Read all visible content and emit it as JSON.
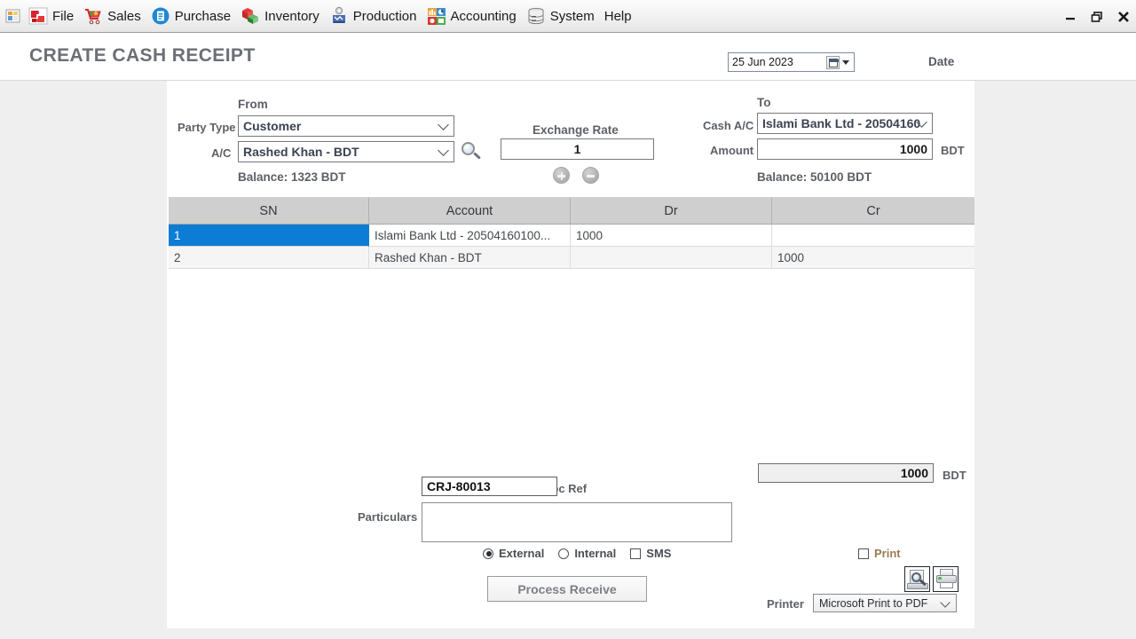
{
  "window": {
    "controls": [
      {
        "name": "minimize",
        "glyph": "–"
      },
      {
        "name": "restore",
        "glyph": "❐"
      },
      {
        "name": "close",
        "glyph": "✕"
      }
    ]
  },
  "menubar": {
    "app_icon": "app-squares-icon",
    "items": [
      {
        "label": "File",
        "icon": "puzzle-icon"
      },
      {
        "label": "Sales",
        "icon": "shopping-cart-icon"
      },
      {
        "label": "Purchase",
        "icon": "document-blue-icon"
      },
      {
        "label": "Inventory",
        "icon": "boxes-icon"
      },
      {
        "label": "Production",
        "icon": "gear-factory-icon"
      },
      {
        "label": "Accounting",
        "icon": "charts-icon"
      },
      {
        "label": "System",
        "icon": "server-icon"
      },
      {
        "label": "Help",
        "icon": "none"
      }
    ]
  },
  "header": {
    "title": "CREATE CASH RECEIPT",
    "date_value": "25 Jun  2023",
    "date_label": "Date"
  },
  "form": {
    "from_header": "From",
    "party_type_label": "Party Type",
    "party_type_value": "Customer",
    "ac_label": "A/C",
    "ac_value": "Rashed Khan - BDT",
    "from_balance": "Balance: 1323 BDT",
    "exchange_rate_label": "Exchange Rate",
    "exchange_rate_value": "1",
    "to_header": "To",
    "cash_ac_label": "Cash A/C",
    "cash_ac_value": "Islami Bank Ltd - 20504160",
    "amount_label": "Amount",
    "amount_value": "1000",
    "amount_unit": "BDT",
    "to_balance": "Balance: 50100 BDT"
  },
  "grid": {
    "columns": [
      "SN",
      "Account",
      "Dr",
      "Cr"
    ],
    "rows": [
      {
        "sn": "1",
        "account": "Islami Bank Ltd - 20504160100...",
        "dr": "1000",
        "cr": "",
        "selected": true
      },
      {
        "sn": "2",
        "account": "Rashed Khan - BDT",
        "dr": "",
        "cr": "1000",
        "selected": false
      }
    ]
  },
  "footer": {
    "doc_ref_label": "Doc Ref",
    "doc_ref_value": "CRJ-80013",
    "particulars_label": "Particulars",
    "particulars_value": "",
    "total_value": "1000",
    "total_unit": "BDT",
    "option_external": "External",
    "option_internal": "Internal",
    "option_sms": "SMS",
    "selected_option": "External",
    "sms_checked": false,
    "process_button": "Process Receive",
    "print_label": "Print",
    "print_checked": false,
    "printer_label": "Printer",
    "printer_value": "Microsoft Print to PDF"
  },
  "colors": {
    "selection_blue": "#0c7cd5",
    "title_gray": "#6c6f76",
    "page_bg": "#efefef",
    "grid_header": "#cfcfcf"
  }
}
